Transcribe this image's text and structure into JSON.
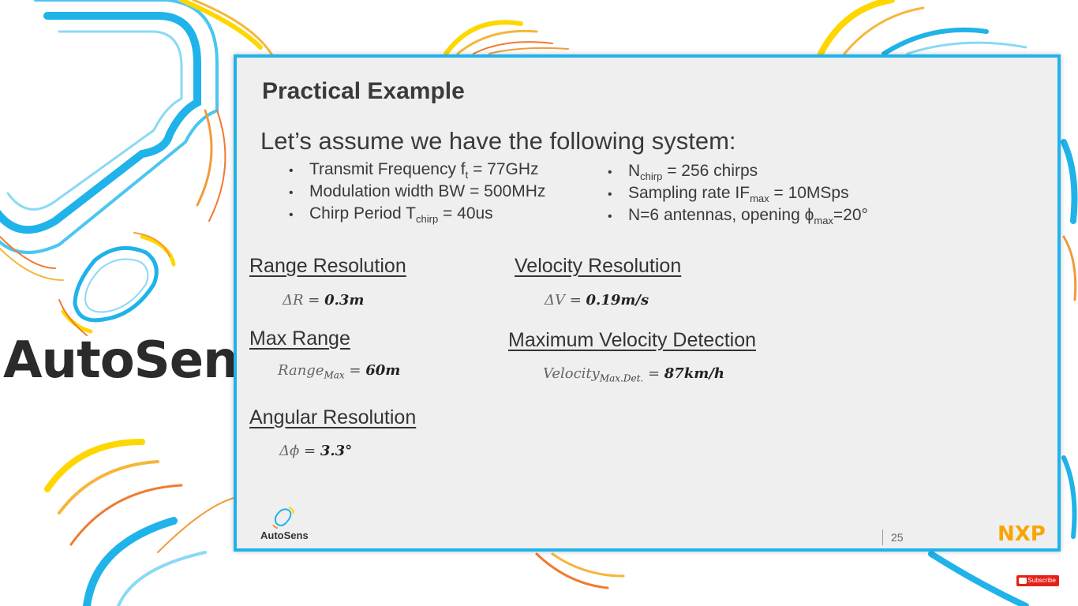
{
  "brand": {
    "name": "AutoSens"
  },
  "slide": {
    "title": "Practical Example",
    "intro": "Let’s assume we have the following system:",
    "bullets_left": [
      {
        "text": "Transmit Frequency f",
        "sub": "t",
        "tail": " = 77GHz"
      },
      {
        "text": "Modulation width  BW = 500MHz",
        "sub": "",
        "tail": ""
      },
      {
        "text": "Chirp Period T",
        "sub": "chirp",
        "tail": " = 40us"
      }
    ],
    "bullets_right": [
      {
        "text": "N",
        "sub": "chirp",
        "tail": " = 256 chirps"
      },
      {
        "text": "Sampling rate IF",
        "sub": "max",
        "tail": " = 10MSps"
      },
      {
        "text": "N=6 antennas, opening ϕ",
        "sub": "max",
        "tail": "=20°"
      }
    ],
    "sections": {
      "range_res": {
        "heading": "Range Resolution",
        "var": "ΔR",
        "sub": "",
        "eq": " = ",
        "value": "0.3m"
      },
      "max_range": {
        "heading": "Max Range",
        "var": "Range",
        "sub": "Max",
        "eq": " = ",
        "value": "60m"
      },
      "angular_res": {
        "heading": "Angular Resolution",
        "var": "Δϕ",
        "sub": "",
        "eq": " = ",
        "value": "3.3°"
      },
      "velocity_res": {
        "heading": "Velocity Resolution",
        "var": "ΔV",
        "sub": "",
        "eq": " = ",
        "value": "0.19m/s"
      },
      "max_velocity": {
        "heading": "Maximum Velocity Detection",
        "var": "Velocity",
        "sub": "Max.Det.",
        "eq": " =  ",
        "value": "87km/h"
      }
    },
    "footer": {
      "logo_text": "AutoSens",
      "page_number": "25",
      "partner_logo": "NXP"
    }
  },
  "subscribe": {
    "label": "Subscribe"
  },
  "colors": {
    "frame": "#1fb3ea",
    "nxp_orange": "#f7a600",
    "nxp_green": "#9fcc3b",
    "nxp_blue": "#6fb7e4"
  },
  "icons": [
    "car-outline-icon",
    "youtube-icon"
  ]
}
